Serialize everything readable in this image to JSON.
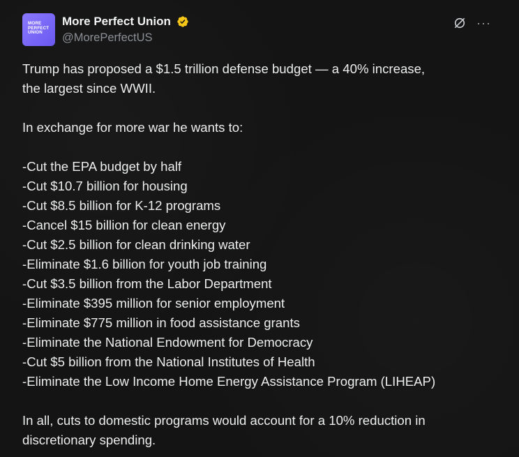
{
  "author": {
    "display_name": "More Perfect Union",
    "handle": "@MorePerfectUS",
    "avatar_text": "MORE\nPERFECT\nUNION",
    "verified_color": "#f5c518"
  },
  "body": {
    "intro": [
      "Trump has proposed a $1.5 trillion defense budget — a 40% increase,",
      "the largest since WWII."
    ],
    "exchange": "In exchange for more war he wants to:",
    "cuts": [
      "-Cut the EPA budget by half",
      "-Cut $10.7 billion for housing",
      "-Cut $8.5 billion for K-12 programs",
      "-Cancel $15 billion for clean energy",
      "-Cut $2.5 billion for clean drinking water",
      "-Eliminate $1.6 billion for youth job training",
      "-Cut $3.5 billion from the Labor Department",
      "-Eliminate $395 million for senior employment",
      "-Eliminate $775 million in food assistance grants",
      "-Eliminate the National Endowment for Democracy",
      "-Cut $5 billion from the National Institutes of Health",
      "-Eliminate the Low Income Home Energy Assistance Program (LIHEAP)"
    ],
    "conclusion": [
      "In all, cuts to domestic programs would account for a 10% reduction in",
      "discretionary spending."
    ]
  },
  "icons": {
    "verified": "verified-badge-icon",
    "grok": "grok-icon",
    "more": "more-options-icon",
    "more_glyph": "···"
  },
  "colors": {
    "background": "#141414",
    "text": "#eceded",
    "handle": "#8a8f95",
    "avatar": "#7a68f8"
  }
}
